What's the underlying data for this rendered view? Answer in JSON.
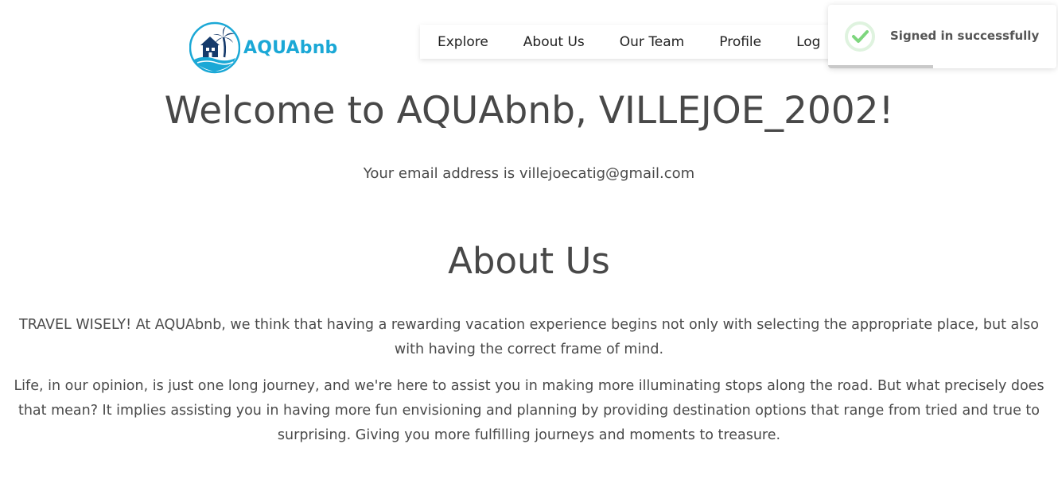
{
  "brand": {
    "name": "AQUAbnb",
    "color": "#1ba8d6",
    "logo_icon": "beach-house-palm-logo"
  },
  "nav": {
    "items": [
      {
        "label": "Explore"
      },
      {
        "label": "About Us"
      },
      {
        "label": "Our Team"
      },
      {
        "label": "Profile"
      },
      {
        "label": "Log"
      }
    ]
  },
  "toast": {
    "message": "Signed in successfully",
    "icon": "check-circle-icon",
    "icon_color": "#7ed67e",
    "progress_fraction": 0.46
  },
  "welcome": {
    "title": "Welcome to AQUAbnb, VILLEJOE_2002!",
    "email_line": "Your email address is villejoecatig@gmail.com"
  },
  "about": {
    "title": "About Us",
    "paragraph1": "TRAVEL WISELY! At AQUAbnb, we think that having a rewarding vacation experience begins not only with selecting the appropriate place, but also with having the correct frame of mind.",
    "paragraph2": "Life, in our opinion, is just one long journey, and we're here to assist you in making more illuminating stops along the road. But what precisely does that mean? It implies assisting you in having more fun envisioning and planning by providing destination options that range from tried and true to surprising. Giving you more fulfilling journeys and moments to treasure."
  }
}
